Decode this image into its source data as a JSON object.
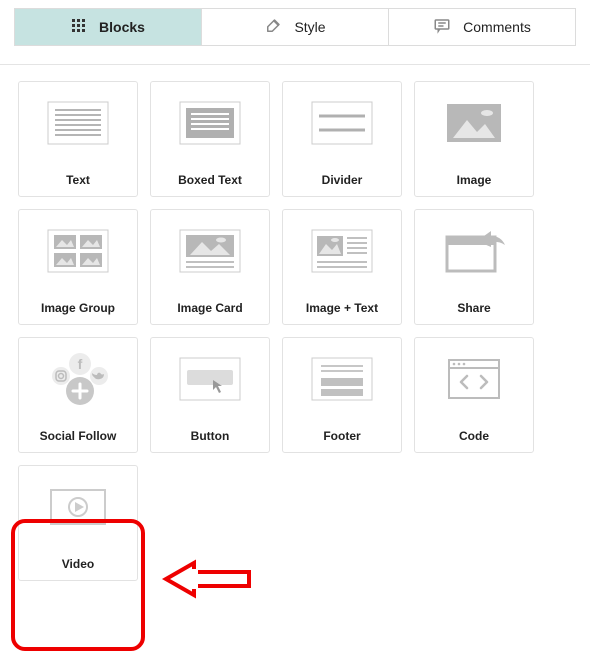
{
  "tabs": {
    "blocks": "Blocks",
    "style": "Style",
    "comments": "Comments"
  },
  "tiles": {
    "text": "Text",
    "boxed_text": "Boxed Text",
    "divider": "Divider",
    "image": "Image",
    "image_group": "Image Group",
    "image_card": "Image Card",
    "image_text": "Image + Text",
    "share": "Share",
    "social": "Social Follow",
    "button": "Button",
    "footer": "Footer",
    "code": "Code",
    "video": "Video"
  }
}
